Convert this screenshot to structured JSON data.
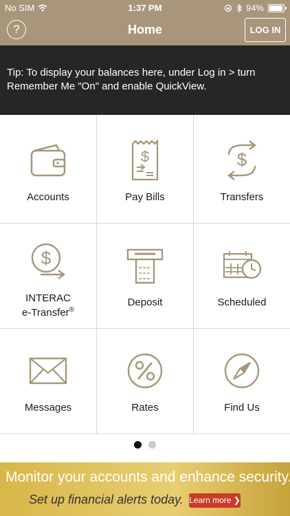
{
  "status": {
    "carrier": "No SIM",
    "time": "1:37 PM",
    "battery": "94%",
    "battery_level": 0.94
  },
  "nav": {
    "title": "Home",
    "login": "LOG IN",
    "help": "?"
  },
  "tip": {
    "text": "Tip: To display your balances here, under Log in > turn Remember Me \"On\" and enable QuickView."
  },
  "tiles": [
    {
      "label": "Accounts",
      "icon": "wallet-icon"
    },
    {
      "label": "Pay Bills",
      "icon": "bill-icon"
    },
    {
      "label": "Transfers",
      "icon": "transfer-icon"
    },
    {
      "label_line1": "INTERAC",
      "label_line2": "e-Transfer",
      "label_sup": "®",
      "icon": "etransfer-icon"
    },
    {
      "label": "Deposit",
      "icon": "deposit-icon"
    },
    {
      "label": "Scheduled",
      "icon": "calendar-clock-icon"
    },
    {
      "label": "Messages",
      "icon": "envelope-icon"
    },
    {
      "label": "Rates",
      "icon": "percent-icon"
    },
    {
      "label": "Find Us",
      "icon": "compass-icon"
    }
  ],
  "pager": {
    "current": 1,
    "total": 2
  },
  "banner": {
    "headline": "Monitor your accounts and enhance security.",
    "subline": "Set up financial alerts today.",
    "button": "Learn more ❯"
  },
  "colors": {
    "gold": "#a8967a",
    "dark": "#262626",
    "banner": "#d8b74a",
    "button": "#c83c28"
  }
}
